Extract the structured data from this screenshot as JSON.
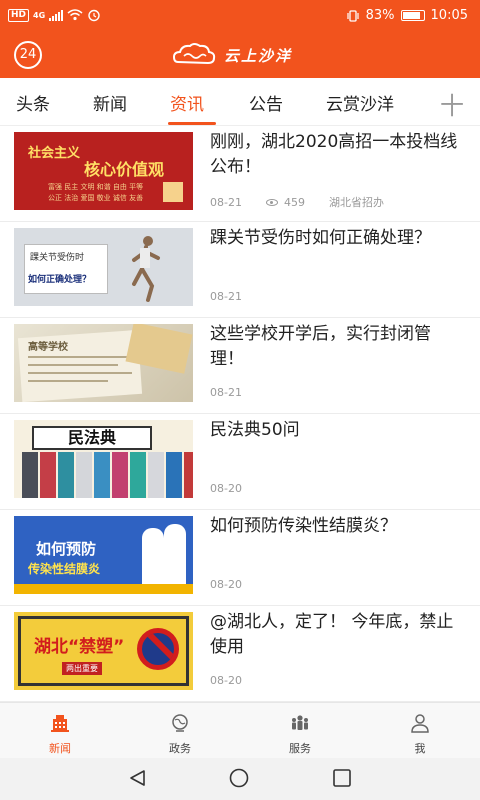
{
  "status_bar": {
    "network_type": "4G",
    "hd_label": "HD",
    "battery": "83%",
    "time": "10:05"
  },
  "header": {
    "badge_number": "24",
    "logo_text": "云上沙洋"
  },
  "tabs": [
    {
      "label": "头条",
      "active": false
    },
    {
      "label": "新闻",
      "active": false
    },
    {
      "label": "资讯",
      "active": true
    },
    {
      "label": "公告",
      "active": false
    },
    {
      "label": "云赏沙洋",
      "active": false
    }
  ],
  "tab_more_symbol": "十",
  "thumbnails": {
    "t1_line1": "社会主义",
    "t1_line2": "核心价值观",
    "t1_small1": "富强 民主 文明 和谐 自由 平等",
    "t1_small2": "公正 法治 爱国 敬业 诚信 友善",
    "t2_line1": "踝关节受伤时",
    "t2_line2": "如何正确处理？",
    "t3_head": "高等学校",
    "t4_sign": "民法典",
    "t5_line1": "如何预防",
    "t5_line2": "传染性结膜炎",
    "t6_text": "湖北“禁塑”",
    "t6_tag": "两出重要"
  },
  "articles": [
    {
      "title": "刚刚，湖北2020高招一本投档线公布！",
      "date": "08-21",
      "views": "459",
      "source": "湖北省招办"
    },
    {
      "title": "踝关节受伤时如何正确处理？",
      "date": "08-21"
    },
    {
      "title": "这些学校开学后，实行封闭管理！",
      "date": "08-21"
    },
    {
      "title": "民法典50问",
      "date": "08-20"
    },
    {
      "title": "如何预防传染性结膜炎？",
      "date": "08-20"
    },
    {
      "title": "@湖北人，定了！ 今年底，禁止使用",
      "date": "08-20"
    }
  ],
  "bottom_nav": [
    {
      "label": "新闻",
      "icon": "building-icon",
      "active": true
    },
    {
      "label": "政务",
      "icon": "globe-icon",
      "active": false
    },
    {
      "label": "服务",
      "icon": "people-icon",
      "active": false
    },
    {
      "label": "我",
      "icon": "person-icon",
      "active": false
    }
  ],
  "colors": {
    "accent": "#f2531d",
    "text": "#222222",
    "meta": "#9a9a9a"
  }
}
